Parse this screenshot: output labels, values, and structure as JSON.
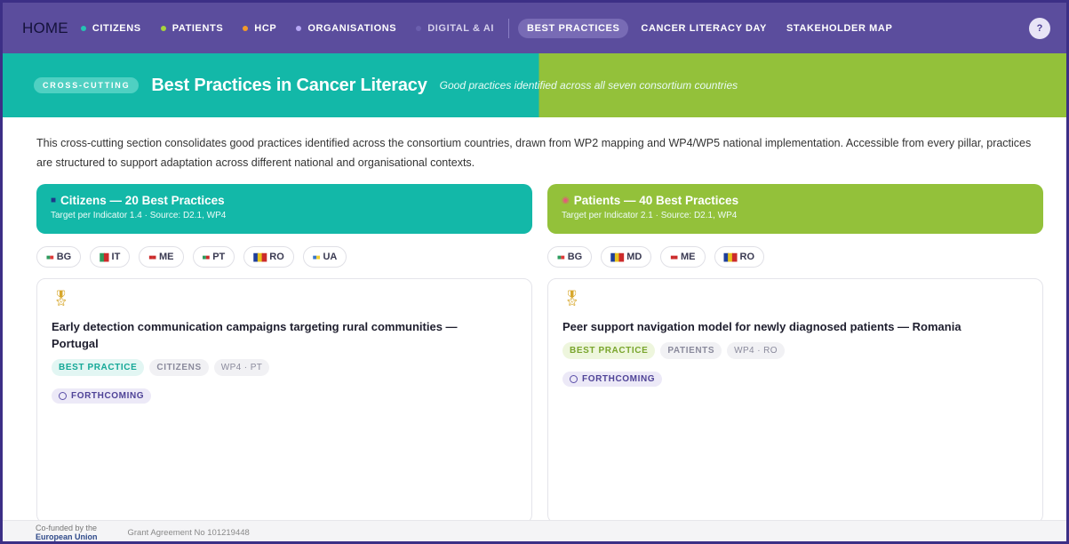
{
  "nav": {
    "home": "HOME",
    "items": [
      {
        "label": "CITIZENS",
        "dot": "#25c3b3"
      },
      {
        "label": "PATIENTS",
        "dot": "#a7d43c"
      },
      {
        "label": "HCP",
        "dot": "#f39a2a"
      },
      {
        "label": "ORGANISATIONS",
        "dot": "#b7a8f5"
      },
      {
        "label": "DIGITAL & AI",
        "dot": "#6b5fae"
      }
    ],
    "active": "BEST PRACTICES",
    "links": [
      "CANCER LITERACY DAY",
      "STAKEHOLDER MAP"
    ],
    "help": "?"
  },
  "banner": {
    "badge": "CROSS-CUTTING",
    "title": "Best Practices in Cancer Literacy",
    "subtitle": "Good practices identified across all seven consortium countries"
  },
  "intro": "This cross-cutting section consolidates good practices identified across the consortium countries, drawn from WP2 mapping and WP4/WP5 national implementation. Accessible from every pillar, practices are structured to support adaptation across different national and organisational contexts.",
  "columns": {
    "left": {
      "icon": "eu-flag-icon",
      "title": "Citizens — 20 Best Practices",
      "meta": "Target per Indicator 1.4 · Source: D2.1, WP4",
      "countries": [
        "BG",
        "IT",
        "ME",
        "PT",
        "RO",
        "UA"
      ],
      "card": {
        "title": "Early detection communication campaigns targeting rural communities — Portugal",
        "tags": [
          "BEST PRACTICE",
          "CITIZENS",
          "WP4 · PT"
        ],
        "status": "FORTHCOMING"
      }
    },
    "right": {
      "icon": "patient-icon",
      "title": "Patients — 40 Best Practices",
      "meta": "Target per Indicator 2.1 · Source: D2.1, WP4",
      "countries": [
        "BG",
        "MD",
        "ME",
        "RO"
      ],
      "card": {
        "title": "Peer support navigation model for newly diagnosed patients — Romania",
        "tags": [
          "BEST PRACTICE",
          "PATIENTS",
          "WP4 · RO"
        ],
        "status": "FORTHCOMING"
      }
    }
  },
  "footer": {
    "eu_line1": "Co-funded by the",
    "eu_line2": "European Union",
    "grant": "Grant Agreement No 101219448"
  }
}
